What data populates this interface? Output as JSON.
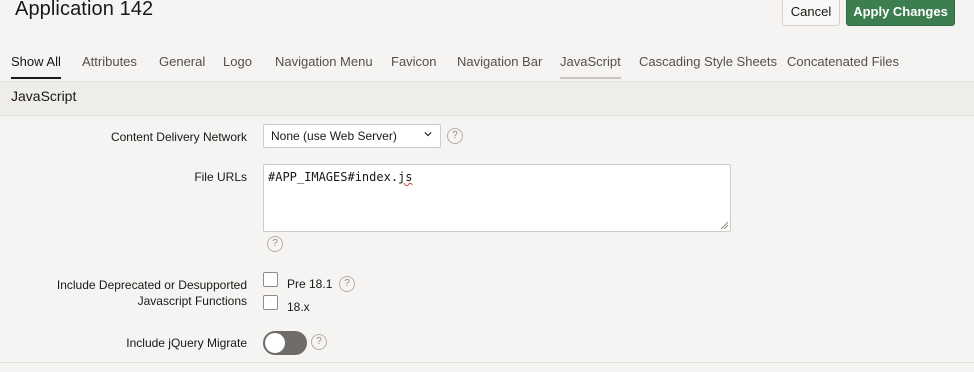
{
  "header": {
    "title": "Application 142",
    "cancel_label": "Cancel",
    "apply_label": "Apply Changes"
  },
  "tabs": [
    {
      "label": "Show All"
    },
    {
      "label": "Attributes"
    },
    {
      "label": "General"
    },
    {
      "label": "Logo"
    },
    {
      "label": "Navigation Menu"
    },
    {
      "label": "Favicon"
    },
    {
      "label": "Navigation Bar"
    },
    {
      "label": "JavaScript"
    },
    {
      "label": "Cascading Style Sheets"
    },
    {
      "label": "Concatenated Files"
    }
  ],
  "section": {
    "title": "JavaScript"
  },
  "form": {
    "cdn": {
      "label": "Content Delivery Network",
      "value": "None (use Web Server)"
    },
    "file_urls": {
      "label": "File URLs",
      "value_prefix": "#APP_IMAGES#index.",
      "value_misspelled": "js"
    },
    "deprecated": {
      "label_line1": "Include Deprecated or Desupported",
      "label_line2": "Javascript Functions",
      "options": [
        {
          "label": "Pre 18.1",
          "checked": false
        },
        {
          "label": "18.x",
          "checked": false
        }
      ]
    },
    "jquery_migrate": {
      "label": "Include jQuery Migrate",
      "on": false
    },
    "help_symbol": "?"
  },
  "colors": {
    "apply_button": "#3d7e51",
    "toggle_off": "#6f6b66",
    "page_background": "#f5f4f2"
  }
}
